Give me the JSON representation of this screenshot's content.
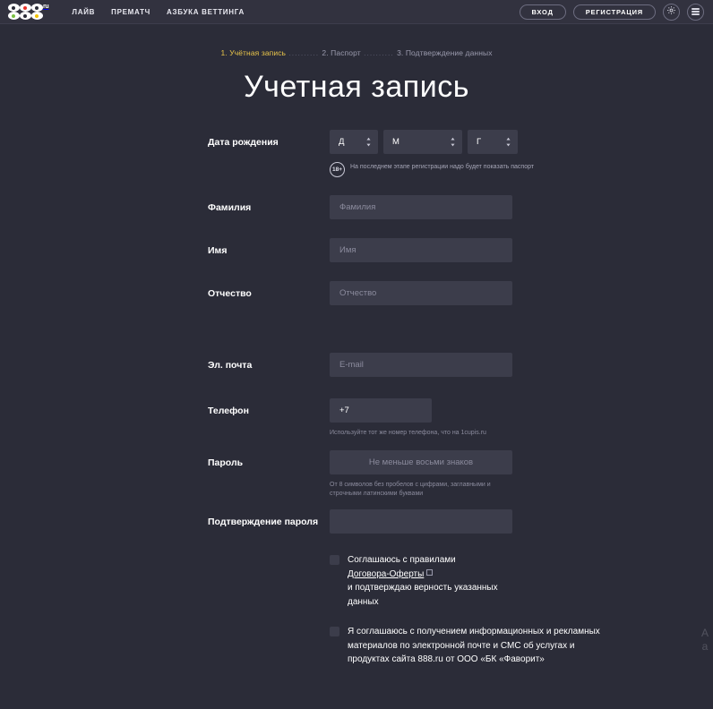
{
  "header": {
    "logo": {
      "text": "888",
      "suffix": "ru",
      "dot_colors": [
        "#7ac143",
        "#e8332a",
        "#f2c200"
      ]
    },
    "nav": [
      {
        "label": "ЛАЙВ",
        "name": "nav-live"
      },
      {
        "label": "ПРЕМАТЧ",
        "name": "nav-prematch"
      },
      {
        "label": "АЗБУКА ВЕТТИНГА",
        "name": "nav-betting-abc"
      }
    ],
    "login_label": "ВХОД",
    "register_label": "РЕГИСТРАЦИЯ",
    "gear_icon": "gear-icon",
    "menu_icon": "hamburger-menu-icon"
  },
  "steps": {
    "step1": "1. Учётная запись",
    "sep1": " .......... ",
    "step2": "2. Паспорт",
    "sep2": " .......... ",
    "step3": "3. Подтверждение данных",
    "active_color": "#e8c44a",
    "inactive_color": "#9a9aad"
  },
  "title": "Учетная запись",
  "form": {
    "dob": {
      "label": "Дата рождения",
      "day": "Д",
      "month": "М",
      "year": "Г"
    },
    "age_note": {
      "badge": "18+",
      "text": "На последнем этапе регистрации надо будет показать паспорт"
    },
    "lastname": {
      "label": "Фамилия",
      "placeholder": "Фамилия",
      "value": ""
    },
    "firstname": {
      "label": "Имя",
      "placeholder": "Имя",
      "value": ""
    },
    "patronymic": {
      "label": "Отчество",
      "placeholder": "Отчество",
      "value": ""
    },
    "email": {
      "label": "Эл. почта",
      "placeholder": "E-mail",
      "value": ""
    },
    "phone": {
      "label": "Телефон",
      "placeholder": "+7",
      "value": "",
      "hint": "Используйте тот же номер телефона, что на 1cupis.ru"
    },
    "password": {
      "label": "Пароль",
      "placeholder": "Не меньше восьми знаков",
      "value": "",
      "hint": "От 8 символов без пробелов с цифрами, заглавными и строчными латинскими буквами"
    },
    "password_confirm": {
      "label": "Подтверждение пароля",
      "placeholder": "",
      "value": ""
    }
  },
  "agreements": [
    {
      "name": "agree-offer",
      "checked": false,
      "line1": "Соглашаюсь с правилами",
      "link": "Договора-Оферты",
      "line2": "и подтверждаю верность указанных",
      "line3": "данных"
    },
    {
      "name": "agree-marketing",
      "checked": false,
      "text": "Я соглашаюсь с получением информационных и рекламных материалов по электронной почте и СМС об услугах и продуктах сайта 888.ru от ООО «БК «Фаворит»"
    }
  ],
  "theme": {
    "page_bg": "#2b2c38",
    "header_bg": "#32323f",
    "input_bg": "#3c3d4b",
    "text": "#ffffff",
    "muted": "#8b8b9d"
  }
}
